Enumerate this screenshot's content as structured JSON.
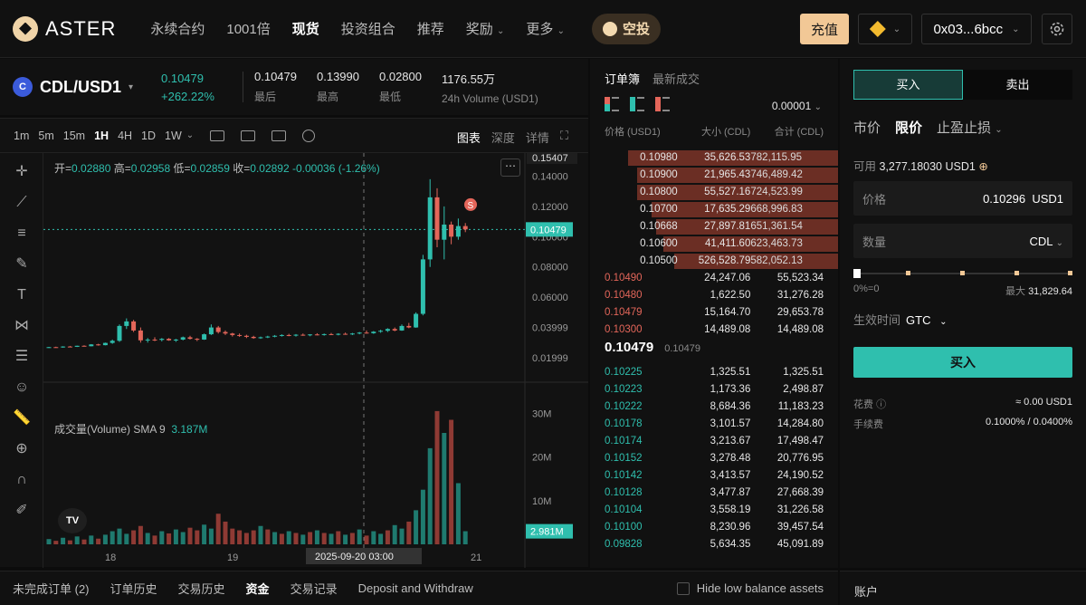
{
  "nav": {
    "logo": "ASTER",
    "items": [
      "永续合约",
      "1001倍",
      "现货",
      "投资组合",
      "推荐",
      "奖励",
      "更多"
    ],
    "airdrop": "空投",
    "deposit": "充值",
    "wallet": "0x03...6bcc"
  },
  "ticker": {
    "pair": "CDL/USD1",
    "price": "0.10479",
    "change": "+262.22%",
    "stats": [
      {
        "value": "0.10479",
        "label": "最后"
      },
      {
        "value": "0.13990",
        "label": "最高"
      },
      {
        "value": "0.02800",
        "label": "最低"
      },
      {
        "value": "1176.55万",
        "label": "24h Volume (USD1)"
      }
    ]
  },
  "chart": {
    "timeframes": [
      "1m",
      "5m",
      "15m",
      "1H",
      "4H",
      "1D",
      "1W"
    ],
    "views": [
      "图表",
      "深度",
      "详情"
    ],
    "ohlc": {
      "o": "0.02880",
      "h": "0.02958",
      "l": "0.02859",
      "c": "0.02892",
      "chg": "-0.00036 (-1.26%)"
    },
    "ohlc_labels": {
      "o": "开=",
      "h": "高=",
      "l": "低=",
      "c": "收="
    },
    "volume_label": "成交量(Volume) SMA 9",
    "volume_sma": "3.187M",
    "tv_logo": "TV",
    "crosshair_date": "2025-09-20   03:00",
    "current_price_tag": "0.10479",
    "current_vol_tag": "2.981M",
    "top_price_tag": "0.15407",
    "marker": "S"
  },
  "chart_data": {
    "type": "candlestick",
    "price_axis": [
      "0.14000",
      "0.12000",
      "0.10000",
      "0.08000",
      "0.06000",
      "0.03999",
      "0.01999"
    ],
    "volume_axis": [
      "30M",
      "20M",
      "10M"
    ],
    "x_ticks": [
      "18",
      "19",
      "21"
    ],
    "last_price": 0.10479,
    "candles": [
      [
        0.0268,
        0.0272,
        0.0265,
        0.027
      ],
      [
        0.027,
        0.0273,
        0.0266,
        0.0268
      ],
      [
        0.0268,
        0.0276,
        0.0266,
        0.0274
      ],
      [
        0.0274,
        0.0278,
        0.027,
        0.0272
      ],
      [
        0.0272,
        0.028,
        0.0271,
        0.0279
      ],
      [
        0.0279,
        0.0282,
        0.0274,
        0.0276
      ],
      [
        0.0276,
        0.029,
        0.0275,
        0.0288
      ],
      [
        0.0288,
        0.0292,
        0.028,
        0.0283
      ],
      [
        0.0283,
        0.03,
        0.0282,
        0.0298
      ],
      [
        0.0298,
        0.032,
        0.0292,
        0.0312
      ],
      [
        0.0312,
        0.042,
        0.0305,
        0.041
      ],
      [
        0.041,
        0.046,
        0.039,
        0.044
      ],
      [
        0.044,
        0.045,
        0.037,
        0.038
      ],
      [
        0.038,
        0.04,
        0.03,
        0.0315
      ],
      [
        0.0315,
        0.033,
        0.03,
        0.032
      ],
      [
        0.032,
        0.0335,
        0.031,
        0.0318
      ],
      [
        0.0318,
        0.033,
        0.0308,
        0.0325
      ],
      [
        0.0325,
        0.033,
        0.0312,
        0.0315
      ],
      [
        0.0315,
        0.0325,
        0.0305,
        0.032
      ],
      [
        0.032,
        0.034,
        0.0315,
        0.0335
      ],
      [
        0.0335,
        0.0345,
        0.032,
        0.0325
      ],
      [
        0.0325,
        0.033,
        0.031,
        0.032
      ],
      [
        0.032,
        0.036,
        0.0318,
        0.0355
      ],
      [
        0.0355,
        0.042,
        0.035,
        0.04
      ],
      [
        0.04,
        0.041,
        0.036,
        0.037
      ],
      [
        0.037,
        0.038,
        0.035,
        0.036
      ],
      [
        0.036,
        0.0365,
        0.034,
        0.035
      ],
      [
        0.035,
        0.036,
        0.0338,
        0.0345
      ],
      [
        0.0345,
        0.0352,
        0.033,
        0.0338
      ],
      [
        0.0338,
        0.0345,
        0.0325,
        0.033
      ],
      [
        0.033,
        0.034,
        0.0325,
        0.0335
      ],
      [
        0.0335,
        0.0345,
        0.033,
        0.034
      ],
      [
        0.034,
        0.035,
        0.0335,
        0.0345
      ],
      [
        0.0345,
        0.0355,
        0.034,
        0.035
      ],
      [
        0.035,
        0.0358,
        0.0342,
        0.0346
      ],
      [
        0.0346,
        0.0356,
        0.034,
        0.0352
      ],
      [
        0.0352,
        0.036,
        0.0345,
        0.0348
      ],
      [
        0.0348,
        0.0356,
        0.0342,
        0.0354
      ],
      [
        0.0354,
        0.0362,
        0.0348,
        0.035
      ],
      [
        0.035,
        0.036,
        0.0346,
        0.0356
      ],
      [
        0.0356,
        0.0364,
        0.035,
        0.0352
      ],
      [
        0.0352,
        0.0362,
        0.0348,
        0.0358
      ],
      [
        0.0358,
        0.0366,
        0.0352,
        0.0354
      ],
      [
        0.0354,
        0.0364,
        0.035,
        0.036
      ],
      [
        0.036,
        0.037,
        0.0355,
        0.0366
      ],
      [
        0.0366,
        0.038,
        0.036,
        0.0362
      ],
      [
        0.0362,
        0.0376,
        0.0358,
        0.0372
      ],
      [
        0.0372,
        0.0385,
        0.0365,
        0.0378
      ],
      [
        0.0378,
        0.0395,
        0.037,
        0.039
      ],
      [
        0.039,
        0.04,
        0.0375,
        0.038
      ],
      [
        0.038,
        0.042,
        0.0378,
        0.041
      ],
      [
        0.041,
        0.043,
        0.0395,
        0.04
      ],
      [
        0.04,
        0.05,
        0.0398,
        0.049
      ],
      [
        0.049,
        0.088,
        0.048,
        0.085
      ],
      [
        0.085,
        0.138,
        0.08,
        0.126
      ],
      [
        0.126,
        0.132,
        0.093,
        0.098
      ],
      [
        0.098,
        0.12,
        0.085,
        0.108
      ],
      [
        0.108,
        0.11,
        0.095,
        0.1
      ],
      [
        0.1,
        0.112,
        0.098,
        0.107
      ],
      [
        0.107,
        0.109,
        0.103,
        0.1048
      ]
    ],
    "volumes": [
      [
        1.2,
        1
      ],
      [
        0.8,
        0
      ],
      [
        1.5,
        1
      ],
      [
        0.9,
        0
      ],
      [
        1.8,
        1
      ],
      [
        1.1,
        0
      ],
      [
        2.0,
        1
      ],
      [
        1.3,
        0
      ],
      [
        2.2,
        1
      ],
      [
        3.0,
        1
      ],
      [
        3.6,
        1
      ],
      [
        2.4,
        1
      ],
      [
        3.2,
        0
      ],
      [
        4.2,
        0
      ],
      [
        2.6,
        1
      ],
      [
        2.0,
        0
      ],
      [
        3.0,
        1
      ],
      [
        2.5,
        0
      ],
      [
        3.4,
        1
      ],
      [
        2.8,
        1
      ],
      [
        3.8,
        0
      ],
      [
        3.2,
        0
      ],
      [
        4.5,
        1
      ],
      [
        3.6,
        1
      ],
      [
        7.0,
        0
      ],
      [
        5.2,
        0
      ],
      [
        3.6,
        0
      ],
      [
        3.2,
        0
      ],
      [
        2.6,
        0
      ],
      [
        3.2,
        0
      ],
      [
        4.2,
        1
      ],
      [
        3.4,
        0
      ],
      [
        2.8,
        1
      ],
      [
        2.4,
        0
      ],
      [
        3.0,
        1
      ],
      [
        2.6,
        0
      ],
      [
        2.2,
        1
      ],
      [
        2.8,
        0
      ],
      [
        3.2,
        1
      ],
      [
        2.6,
        0
      ],
      [
        2.4,
        1
      ],
      [
        3.0,
        0
      ],
      [
        2.2,
        1
      ],
      [
        2.6,
        0
      ],
      [
        3.4,
        1
      ],
      [
        2.0,
        0
      ],
      [
        3.0,
        1
      ],
      [
        2.4,
        1
      ],
      [
        3.2,
        0
      ],
      [
        4.4,
        1
      ],
      [
        3.6,
        1
      ],
      [
        5.2,
        0
      ],
      [
        7.8,
        1
      ],
      [
        12.5,
        1
      ],
      [
        22.0,
        1
      ],
      [
        30.5,
        0
      ],
      [
        25.5,
        1
      ],
      [
        28.5,
        0
      ],
      [
        14.0,
        1
      ],
      [
        3.0,
        1
      ]
    ]
  },
  "orderbook": {
    "tabs": [
      "订单簿",
      "最新成交"
    ],
    "tick": "0.00001",
    "headers": [
      "价格 (USD1)",
      "大小 (CDL)",
      "合计 (CDL)"
    ],
    "asks": [
      [
        "0.10980",
        "35,626.53",
        "782,115.95",
        0.9
      ],
      [
        "0.10900",
        "21,965.43",
        "746,489.42",
        0.86
      ],
      [
        "0.10800",
        "55,527.16",
        "724,523.99",
        0.86
      ],
      [
        "0.10700",
        "17,635.29",
        "668,996.83",
        0.8
      ],
      [
        "0.10668",
        "27,897.81",
        "651,361.54",
        0.78
      ],
      [
        "0.10600",
        "41,411.60",
        "623,463.73",
        0.75
      ],
      [
        "0.10500",
        "526,528.79",
        "582,052.13",
        0.7
      ],
      [
        "0.10490",
        "24,247.06",
        "55,523.34",
        0
      ],
      [
        "0.10480",
        "1,622.50",
        "31,276.28",
        0
      ],
      [
        "0.10479",
        "15,164.70",
        "29,653.78",
        0
      ],
      [
        "0.10300",
        "14,489.08",
        "14,489.08",
        0
      ]
    ],
    "mid_price": "0.10479",
    "mid_sub": "0.10479",
    "bids": [
      [
        "0.10225",
        "1,325.51",
        "1,325.51"
      ],
      [
        "0.10223",
        "1,173.36",
        "2,498.87"
      ],
      [
        "0.10222",
        "8,684.36",
        "11,183.23"
      ],
      [
        "0.10178",
        "3,101.57",
        "14,284.80"
      ],
      [
        "0.10174",
        "3,213.67",
        "17,498.47"
      ],
      [
        "0.10152",
        "3,278.48",
        "20,776.95"
      ],
      [
        "0.10142",
        "3,413.57",
        "24,190.52"
      ],
      [
        "0.10128",
        "3,477.87",
        "27,668.39"
      ],
      [
        "0.10104",
        "3,558.19",
        "31,226.58"
      ],
      [
        "0.10100",
        "8,230.96",
        "39,457.54"
      ],
      [
        "0.09828",
        "5,634.35",
        "45,091.89"
      ]
    ]
  },
  "trade": {
    "buy_tab": "买入",
    "sell_tab": "卖出",
    "order_types": [
      "市价",
      "限价",
      "止盈止损"
    ],
    "available_label": "可用",
    "available_value": "3,277.18030 USD1",
    "price_label": "价格",
    "price_value": "0.10296",
    "price_unit": "USD1",
    "qty_label": "数量",
    "qty_unit": "CDL",
    "slider_min": "0%=0",
    "slider_max_label": "最大",
    "slider_max": "31,829.64",
    "tif_label": "生效时间",
    "tif_value": "GTC",
    "buy_button": "买入",
    "cost_label": "花费",
    "cost_value": "≈ 0.00 USD1",
    "fee_label": "手续费",
    "fee_value": "0.1000% / 0.0400%"
  },
  "bottom": {
    "tabs": [
      "未完成订单 (2)",
      "订单历史",
      "交易历史",
      "资金",
      "交易记录",
      "Deposit and Withdraw"
    ],
    "hide_low": "Hide low balance assets",
    "account": "账户"
  },
  "colors": {
    "up": "#2fbfae",
    "down": "#e4665a",
    "accent": "#f2c896"
  }
}
